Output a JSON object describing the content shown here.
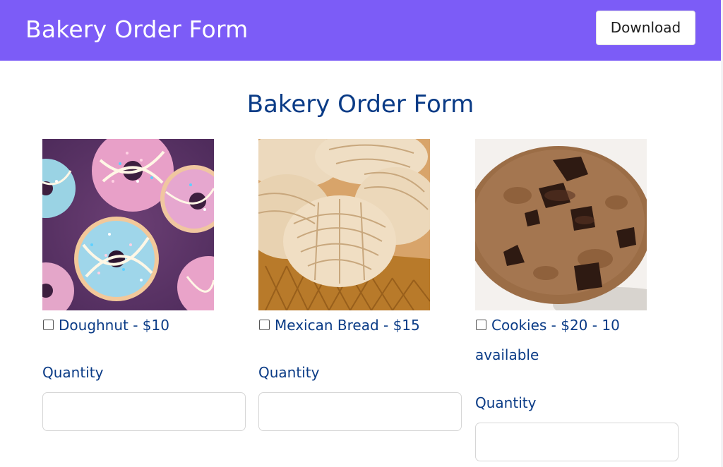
{
  "header": {
    "title": "Bakery Order Form",
    "download_label": "Download",
    "bar_color": "#7c5cf7"
  },
  "main": {
    "heading": "Bakery Order Form",
    "text_color": "#0a3b86",
    "products": [
      {
        "label": "Doughnut - $10",
        "image": "doughnuts-with-sprinkles-photo",
        "quantity_label": "Quantity",
        "quantity_value": "",
        "checked": false
      },
      {
        "label": "Mexican Bread - $15",
        "image": "conchas-in-basket-photo",
        "quantity_label": "Quantity",
        "quantity_value": "",
        "checked": false
      },
      {
        "label_line1": "Cookies - $20 - 10",
        "label_line2": "available",
        "image": "chocolate-chip-cookie-photo",
        "quantity_label": "Quantity",
        "quantity_value": "",
        "checked": false
      }
    ]
  }
}
